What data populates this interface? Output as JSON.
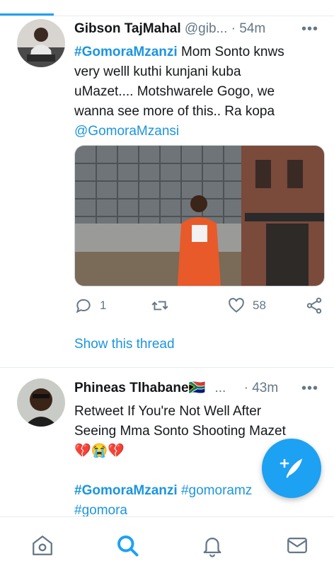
{
  "tweets": [
    {
      "author_name": "Gibson TajMahal",
      "handle": "@gib...",
      "time_sep": "·",
      "time": "54m",
      "text_line1_hashtag": "#GomoraMzanzi",
      "text_line1_rest": " Mom Sonto knws",
      "text_line2": "very welll kuthi kunjani kuba",
      "text_line3": "uMazet.... Motshwarele Gogo, we",
      "text_line4": "wanna see more of this.. Ra kopa",
      "text_line5_mention": "@GomoraMzansi",
      "reply_count": "1",
      "retweet_count": "",
      "like_count": "58",
      "show_thread": "Show this thread"
    },
    {
      "author_name": "Phineas Tlhabane",
      "flag": "🇿🇦",
      "handle": "...",
      "time_sep": "·",
      "time": "43m",
      "text_line1": "Retweet If You're Not Well After",
      "text_line2": "Seeing Mma Sonto Shooting Mazet",
      "text_line3_emoji": "💔😭💔",
      "hashtag1": "#GomoraMzanzi",
      "hashtag2": "#gomoramz",
      "hashtag3": "#gomora"
    }
  ],
  "colors": {
    "accent": "#1da1f2",
    "link": "#1b95e0",
    "muted": "#657786"
  },
  "icons": [
    "reply-icon",
    "retweet-icon",
    "like-icon",
    "share-icon",
    "compose-tweet-icon",
    "home-icon",
    "search-icon",
    "notifications-icon",
    "messages-icon"
  ]
}
